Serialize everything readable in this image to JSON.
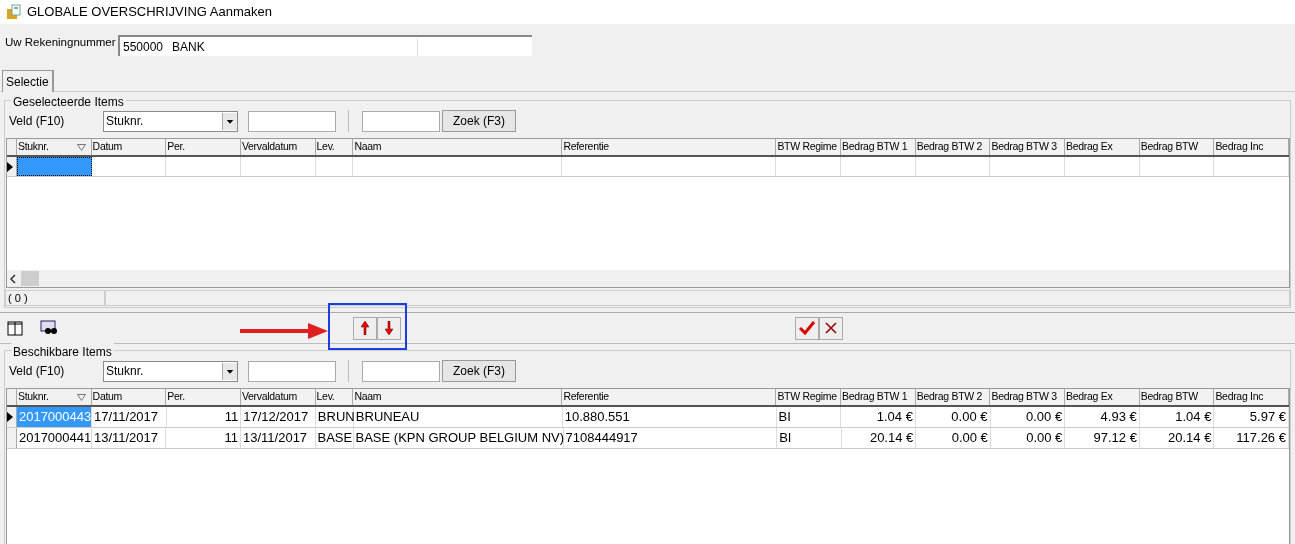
{
  "window": {
    "title": "GLOBALE OVERSCHRIJVING Aanmaken"
  },
  "account": {
    "label": "Uw Rekeningnummer",
    "number": "550000",
    "name": "BANK"
  },
  "tabs": [
    {
      "label": "Selectie",
      "selected": true
    }
  ],
  "selected_items": {
    "title": "Geselecteerde Items",
    "filter": {
      "label": "Veld (F10)",
      "field": "Stuknr.",
      "search_button": "Zoek (F3)"
    },
    "columns": [
      {
        "label": "Stuknr.",
        "sorted": true
      },
      {
        "label": "Datum",
        "sorted": false
      },
      {
        "label": "Per.",
        "sorted": false
      },
      {
        "label": "Vervaldatum",
        "sorted": false
      },
      {
        "label": "Lev.",
        "sorted": false
      },
      {
        "label": "Naam",
        "sorted": false
      },
      {
        "label": "Referentie",
        "sorted": false
      },
      {
        "label": "BTW Regime",
        "sorted": false
      },
      {
        "label": "Bedrag BTW 1",
        "sorted": false
      },
      {
        "label": "Bedrag BTW 2",
        "sorted": false
      },
      {
        "label": "Bedrag BTW 3",
        "sorted": false
      },
      {
        "label": "Bedrag Ex",
        "sorted": false
      },
      {
        "label": "Bedrag BTW",
        "sorted": false
      },
      {
        "label": "Bedrag Inc",
        "sorted": false
      }
    ],
    "new_row": {
      "selected": true
    },
    "status": "( 0 )"
  },
  "available_items": {
    "title": "Beschikbare Items",
    "filter": {
      "label": "Veld (F10)",
      "field": "Stuknr.",
      "search_button": "Zoek (F3)"
    },
    "columns": [
      {
        "label": "Stuknr.",
        "sorted": true
      },
      {
        "label": "Datum",
        "sorted": false
      },
      {
        "label": "Per.",
        "sorted": false
      },
      {
        "label": "Vervaldatum",
        "sorted": false
      },
      {
        "label": "Lev.",
        "sorted": false
      },
      {
        "label": "Naam",
        "sorted": false
      },
      {
        "label": "Referentie",
        "sorted": false
      },
      {
        "label": "BTW Regime",
        "sorted": false
      },
      {
        "label": "Bedrag BTW 1",
        "sorted": false
      },
      {
        "label": "Bedrag BTW 2",
        "sorted": false
      },
      {
        "label": "Bedrag BTW 3",
        "sorted": false
      },
      {
        "label": "Bedrag Ex",
        "sorted": false
      },
      {
        "label": "Bedrag BTW",
        "sorted": false
      },
      {
        "label": "Bedrag Inc",
        "sorted": false
      }
    ],
    "rows": [
      {
        "selected": true,
        "cells": [
          "2017000443",
          "17/11/2017",
          "11",
          "17/12/2017",
          "BRUN",
          "BRUNEAU",
          "10.880.551",
          "BI",
          "1.04 €",
          "0.00 €",
          "0.00 €",
          "4.93 €",
          "1.04 €",
          "5.97 €"
        ]
      },
      {
        "selected": false,
        "cells": [
          "2017000441",
          "13/11/2017",
          "11",
          "13/11/2017",
          "BASE",
          "BASE (KPN GROUP BELGIUM NV)",
          "7108444917",
          "BI",
          "20.14 €",
          "0.00 €",
          "0.00 €",
          "97.12 €",
          "20.14 €",
          "117.26 €"
        ]
      }
    ]
  }
}
